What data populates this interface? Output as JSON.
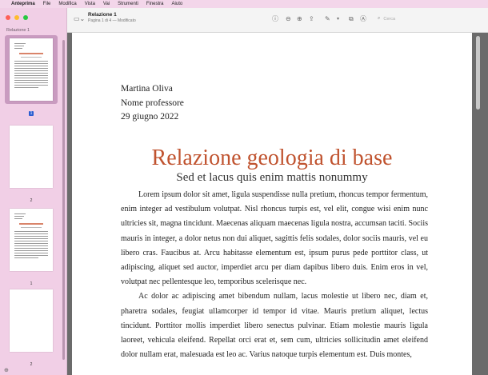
{
  "menubar": {
    "app": "Anteprima",
    "items": [
      "File",
      "Modifica",
      "Vista",
      "Vai",
      "Strumenti",
      "Finestra",
      "Aiuto"
    ]
  },
  "sidebar": {
    "title": "Relazione 1",
    "thumbnails": [
      {
        "label": "1",
        "selected": true
      },
      {
        "label": "2",
        "selected": false
      },
      {
        "label": "1",
        "selected": false
      },
      {
        "label": "2",
        "selected": false
      }
    ]
  },
  "toolbar": {
    "doc_title": "Relazione 1",
    "doc_subtitle": "Pagina 1 di 4 — Modificato",
    "search_placeholder": "Cerca"
  },
  "document": {
    "author": "Martina Oliva",
    "professor": "Nome professore",
    "date": "29 giugno 2022",
    "title": "Relazione geologia di base",
    "subtitle": "Sed et lacus quis enim mattis nonummy",
    "paragraph1": "Lorem ipsum dolor sit amet, ligula suspendisse nulla pretium, rhoncus tempor fermentum, enim integer ad vestibulum volutpat. Nisl rhoncus turpis est, vel elit, congue wisi enim nunc ultricies sit, magna tincidunt. Maecenas aliquam maecenas ligula nostra, accumsan taciti. Sociis mauris in integer, a dolor netus non dui aliquet, sagittis felis sodales, dolor sociis mauris, vel eu libero cras. Faucibus at. Arcu habitasse elementum est, ipsum purus pede porttitor class, ut adipiscing, aliquet sed auctor, imperdiet arcu per diam dapibus libero duis. Enim eros in vel, volutpat nec pellentesque leo, temporibus scelerisque nec.",
    "paragraph2": "Ac dolor ac adipiscing amet bibendum nullam, lacus molestie ut libero nec, diam et, pharetra sodales, feugiat ullamcorper id tempor id vitae. Mauris pretium aliquet, lectus tincidunt. Porttitor mollis imperdiet libero senectus pulvinar. Etiam molestie mauris ligula laoreet, vehicula eleifend. Repellat orci erat et, sem cum, ultricies sollicitudin amet eleifend dolor nullam erat, malesuada est leo ac. Varius natoque turpis elementum est. Duis montes,"
  }
}
